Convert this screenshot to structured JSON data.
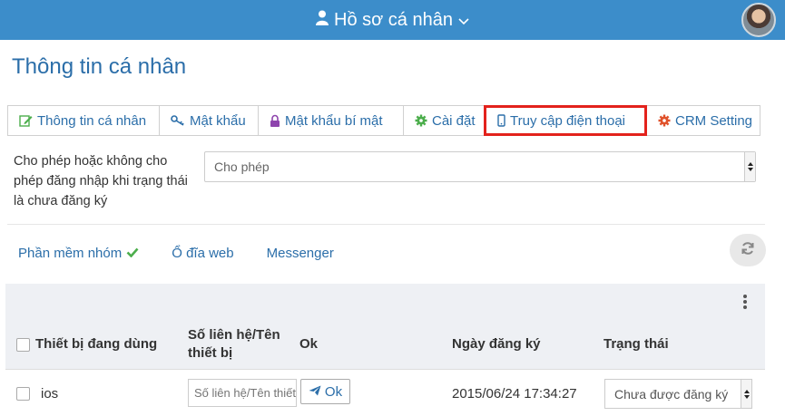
{
  "header": {
    "title": "Hồ sơ cá nhân",
    "accent_color": "#3c8dca",
    "user_icon": "user-icon",
    "menu_icon": "chevron-down-icon"
  },
  "page": {
    "title": "Thông tin cá nhân"
  },
  "tabs": [
    {
      "label": "Thông tin cá nhân",
      "icon": "edit-icon"
    },
    {
      "label": "Mật khẩu",
      "icon": "key-icon"
    },
    {
      "label": "Mật khẩu bí mật",
      "icon": "lock-icon"
    },
    {
      "label": "Cài đặt",
      "icon": "gear-icon"
    },
    {
      "label": "Truy cập điện thoại",
      "icon": "mobile-icon",
      "active": true,
      "highlight_color": "#e3221c"
    },
    {
      "label": "CRM Setting",
      "icon": "gear-icon"
    }
  ],
  "setting": {
    "label": "Cho phép hoặc không cho phép đăng nhập khi trạng thái là chưa đăng ký",
    "value": "Cho phép"
  },
  "subnav": {
    "items": [
      "Phần mềm nhóm",
      "Ổ đĩa web",
      "Messenger"
    ],
    "check_color": "#4cae4c"
  },
  "table": {
    "columns": {
      "device": "Thiết bị đang dùng",
      "contact": "Số liên hệ/Tên thiết bị",
      "ok": "Ok",
      "date": "Ngày đăng ký",
      "status": "Trạng thái"
    },
    "rows": [
      {
        "device": "ios",
        "contact_placeholder": "Số liên hệ/Tên thiết bị",
        "ok_label": "Ok",
        "date": "2015/06/24 17:34:27",
        "status": "Chưa được đăng ký"
      }
    ]
  }
}
